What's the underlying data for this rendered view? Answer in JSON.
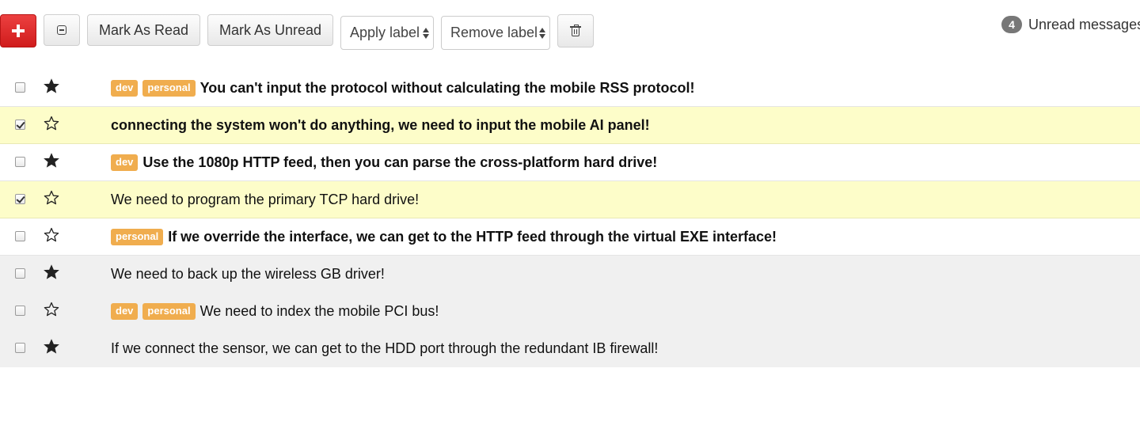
{
  "toolbar": {
    "compose_icon": "plus-icon",
    "select_all_icon": "minus-square-icon",
    "mark_read_label": "Mark As Read",
    "mark_unread_label": "Mark As Unread",
    "apply_label_selected": "Apply label",
    "remove_label_selected": "Remove label",
    "delete_icon": "trash-icon",
    "unread_count": "4",
    "unread_label": "Unread messages",
    "colors": {
      "compose_button": "#d9302c",
      "badge": "#777777"
    }
  },
  "colors": {
    "label_bg": "#f0ad4e",
    "selected_row_bg": "#fdfdc9",
    "read_row_bg": "#f0f0f0",
    "unread_row_bg": "#ffffff"
  },
  "messages": [
    {
      "subject": "You can't input the protocol without calculating the mobile RSS protocol!",
      "labels": [
        "dev",
        "personal"
      ],
      "starred": true,
      "checked": false,
      "read": false
    },
    {
      "subject": "connecting the system won't do anything, we need to input the mobile AI panel!",
      "labels": [],
      "starred": false,
      "checked": true,
      "read": false
    },
    {
      "subject": "Use the 1080p HTTP feed, then you can parse the cross-platform hard drive!",
      "labels": [
        "dev"
      ],
      "starred": true,
      "checked": false,
      "read": false
    },
    {
      "subject": "We need to program the primary TCP hard drive!",
      "labels": [],
      "starred": false,
      "checked": true,
      "read": true
    },
    {
      "subject": "If we override the interface, we can get to the HTTP feed through the virtual EXE interface!",
      "labels": [
        "personal"
      ],
      "starred": false,
      "checked": false,
      "read": false
    },
    {
      "subject": "We need to back up the wireless GB driver!",
      "labels": [],
      "starred": true,
      "checked": false,
      "read": true
    },
    {
      "subject": "We need to index the mobile PCI bus!",
      "labels": [
        "dev",
        "personal"
      ],
      "starred": false,
      "checked": false,
      "read": true
    },
    {
      "subject": "If we connect the sensor, we can get to the HDD port through the redundant IB firewall!",
      "labels": [],
      "starred": true,
      "checked": false,
      "read": true
    }
  ]
}
